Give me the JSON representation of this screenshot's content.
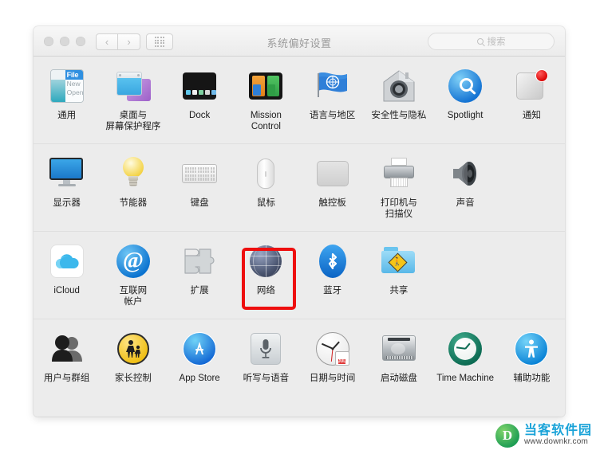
{
  "window": {
    "title": "系统偏好设置",
    "traffic_lights": [
      "close",
      "minimize",
      "zoom"
    ],
    "nav_back_label": "‹",
    "nav_forward_label": "›",
    "show_all_label": "show-all-grid",
    "search": {
      "placeholder": "搜索",
      "value": ""
    }
  },
  "highlight": {
    "target": "网络",
    "color": "#ee0e0e"
  },
  "rows": [
    {
      "items": [
        {
          "label": "通用",
          "icon": "general-icon",
          "menu": {
            "file": "File",
            "new": "New",
            "open": "Open"
          }
        },
        {
          "label": "桌面与\n屏幕保护程序",
          "label_line1": "桌面与",
          "label_line2": "屏幕保护程序",
          "icon": "desktop-screensaver-icon"
        },
        {
          "label": "Dock",
          "icon": "dock-icon"
        },
        {
          "label": "Mission\nControl",
          "label_line1": "Mission",
          "label_line2": "Control",
          "icon": "mission-control-icon"
        },
        {
          "label": "语言与地区",
          "icon": "language-region-icon"
        },
        {
          "label": "安全性与隐私",
          "icon": "security-privacy-icon"
        },
        {
          "label": "Spotlight",
          "icon": "spotlight-icon"
        },
        {
          "label": "通知",
          "icon": "notifications-icon",
          "badge": true
        }
      ]
    },
    {
      "items": [
        {
          "label": "显示器",
          "icon": "displays-icon"
        },
        {
          "label": "节能器",
          "icon": "energy-saver-icon"
        },
        {
          "label": "键盘",
          "icon": "keyboard-icon"
        },
        {
          "label": "鼠标",
          "icon": "mouse-icon"
        },
        {
          "label": "触控板",
          "icon": "trackpad-icon"
        },
        {
          "label": "打印机与\n扫描仪",
          "label_line1": "打印机与",
          "label_line2": "扫描仪",
          "icon": "printers-scanners-icon"
        },
        {
          "label": "声音",
          "icon": "sound-icon"
        },
        {
          "label": "",
          "icon": "",
          "empty": true
        }
      ]
    },
    {
      "items": [
        {
          "label": "iCloud",
          "icon": "icloud-icon"
        },
        {
          "label": "互联网\n帐户",
          "label_line1": "互联网",
          "label_line2": "帐户",
          "icon": "internet-accounts-icon"
        },
        {
          "label": "扩展",
          "icon": "extensions-icon"
        },
        {
          "label": "网络",
          "icon": "network-icon",
          "highlighted": true
        },
        {
          "label": "蓝牙",
          "icon": "bluetooth-icon"
        },
        {
          "label": "共享",
          "icon": "sharing-icon"
        },
        {
          "label": "",
          "icon": "",
          "empty": true
        },
        {
          "label": "",
          "icon": "",
          "empty": true
        }
      ]
    },
    {
      "items": [
        {
          "label": "用户与群组",
          "icon": "users-groups-icon"
        },
        {
          "label": "家长控制",
          "icon": "parental-controls-icon"
        },
        {
          "label": "App Store",
          "icon": "app-store-icon"
        },
        {
          "label": "听写与语音",
          "icon": "dictation-speech-icon"
        },
        {
          "label": "日期与时间",
          "icon": "date-time-icon",
          "calendar": {
            "month": "JUL",
            "day": "18"
          }
        },
        {
          "label": "启动磁盘",
          "icon": "startup-disk-icon"
        },
        {
          "label": "Time Machine",
          "icon": "time-machine-icon"
        },
        {
          "label": "辅助功能",
          "icon": "accessibility-icon"
        }
      ]
    }
  ],
  "watermark": {
    "logo": "D",
    "cn": "当客软件园",
    "url": "www.downkr.com"
  }
}
